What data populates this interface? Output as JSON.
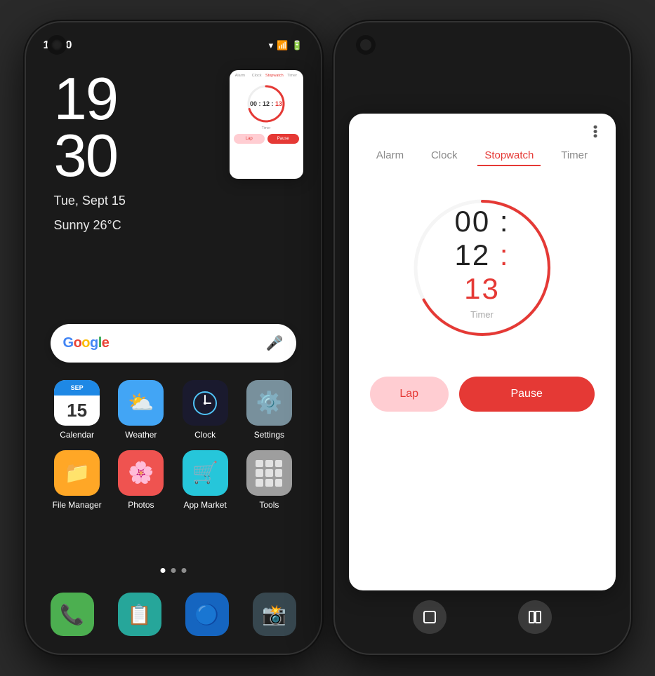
{
  "phones": {
    "left": {
      "statusBar": {
        "time": "19:30",
        "icons": [
          "wifi",
          "signal",
          "battery"
        ]
      },
      "bigTime": {
        "hour": "19",
        "minute": "30",
        "date": "Tue, Sept 15",
        "weather": "Sunny 26°C"
      },
      "widget": {
        "tabs": [
          "Alarm",
          "Clock",
          "Stopwatch",
          "Timer"
        ],
        "activeTab": "Stopwatch",
        "time": "00 : 12 : 13",
        "timeMinutes": "00 : 12",
        "timeSeconds": "13",
        "label": "Timer",
        "lapLabel": "Lap",
        "pauseLabel": "Pause"
      },
      "searchBar": {
        "logoText": "Google",
        "micIcon": "🎤"
      },
      "apps": [
        {
          "name": "Calendar",
          "type": "calendar",
          "date": "15",
          "month": "SEP"
        },
        {
          "name": "Weather",
          "type": "weather"
        },
        {
          "name": "Clock",
          "type": "clock"
        },
        {
          "name": "Settings",
          "type": "settings"
        },
        {
          "name": "File Manager",
          "type": "filemanager"
        },
        {
          "name": "Photos",
          "type": "photos"
        },
        {
          "name": "App Market",
          "type": "appmarket"
        },
        {
          "name": "Tools",
          "type": "tools"
        }
      ],
      "dock": [
        {
          "name": "Phone",
          "type": "phone"
        },
        {
          "name": "Notes",
          "type": "notes"
        },
        {
          "name": "Browser",
          "type": "browser"
        },
        {
          "name": "Camera",
          "type": "camera"
        }
      ]
    },
    "right": {
      "clockApp": {
        "tabs": [
          "Alarm",
          "Clock",
          "Stopwatch",
          "Timer"
        ],
        "activeTab": "Stopwatch",
        "time": {
          "hours": "00",
          "minutes": "12",
          "seconds": "13",
          "separator1": " : ",
          "separator2": " : "
        },
        "timerLabel": "Timer",
        "lapButton": "Lap",
        "pauseButton": "Pause"
      },
      "navButtons": [
        "recents",
        "split"
      ]
    }
  }
}
